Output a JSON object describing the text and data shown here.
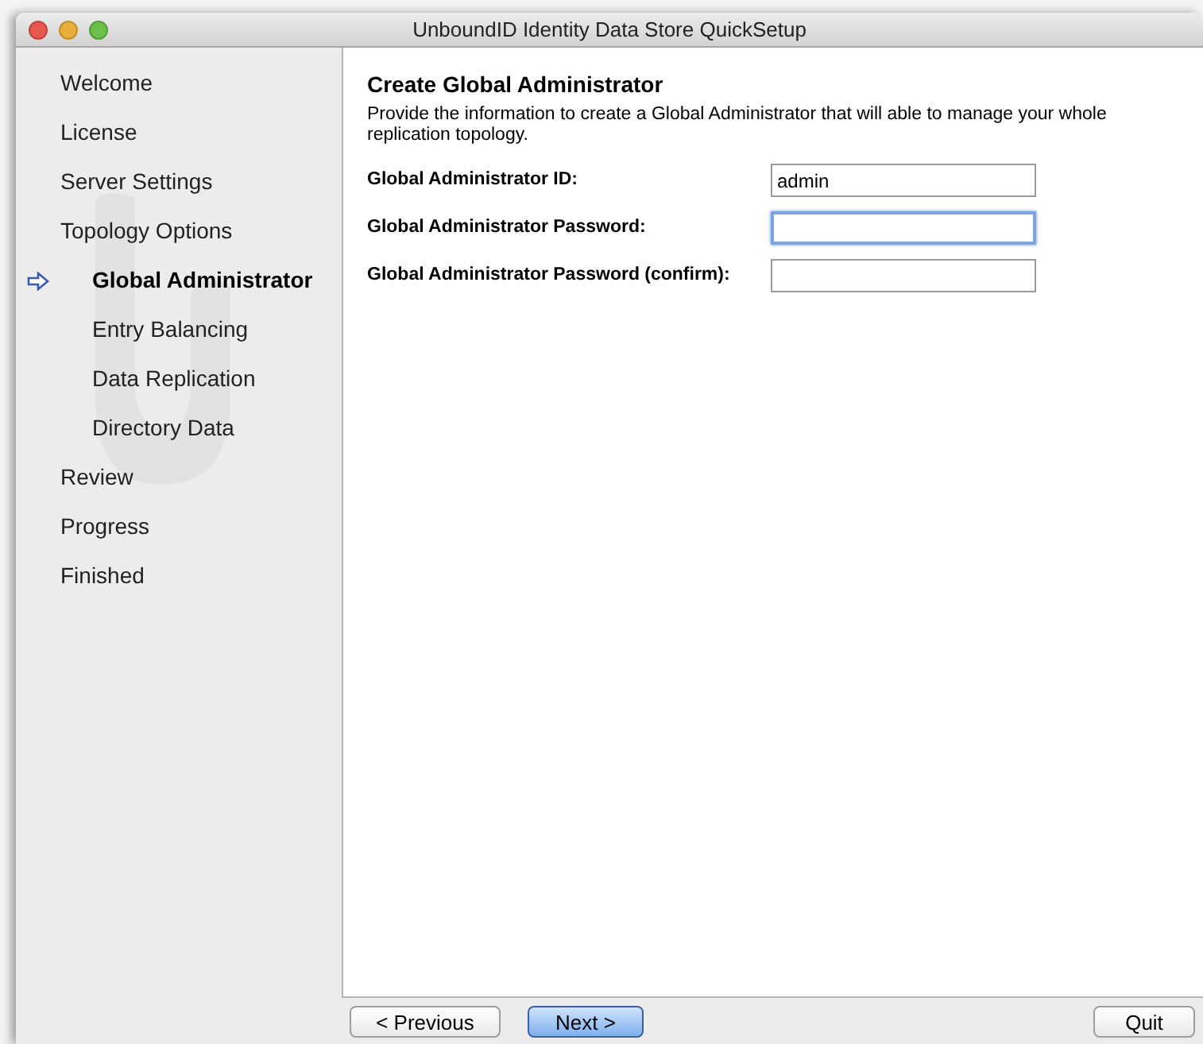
{
  "window": {
    "title": "UnboundID Identity Data Store QuickSetup"
  },
  "steps": [
    {
      "label": "Welcome",
      "selected": false
    },
    {
      "label": "License",
      "selected": false
    },
    {
      "label": "Server Settings",
      "selected": false
    },
    {
      "label": "Topology Options",
      "selected": false,
      "children": [
        {
          "label": "Global Administrator",
          "selected": true
        },
        {
          "label": "Entry Balancing",
          "selected": false
        },
        {
          "label": "Data Replication",
          "selected": false
        },
        {
          "label": "Directory Data",
          "selected": false
        }
      ]
    },
    {
      "label": "Review",
      "selected": false
    },
    {
      "label": "Progress",
      "selected": false
    },
    {
      "label": "Finished",
      "selected": false
    }
  ],
  "panel": {
    "title": "Create Global Administrator",
    "description": "Provide the information to create a Global Administrator that will able to manage your whole replication topology.",
    "fields": [
      {
        "label": "Global Administrator ID:",
        "value": "admin",
        "focused": false
      },
      {
        "label": "Global Administrator Password:",
        "focused": true
      },
      {
        "label": "Global Administrator Password (confirm):",
        "focused": false
      }
    ]
  },
  "buttons": [
    {
      "label": "< Previous",
      "default": false
    },
    {
      "label": "Next >",
      "default": true
    },
    {
      "label": "Quit",
      "default": false
    }
  ]
}
